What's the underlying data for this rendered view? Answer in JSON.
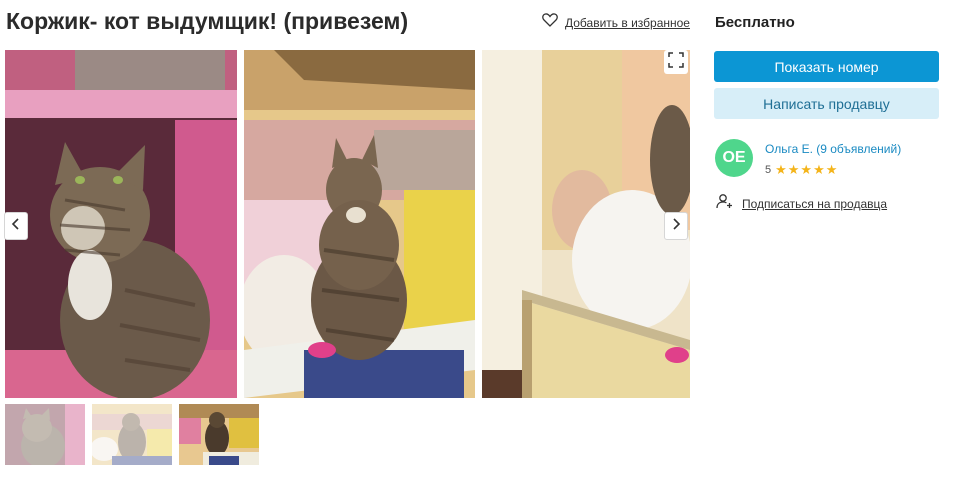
{
  "listing": {
    "title": "Коржик- кот выдумщик! (привезем)",
    "favorite_label": "Добавить в избранное",
    "price": "Бесплатно"
  },
  "actions": {
    "show_phone": "Показать номер",
    "write_seller": "Написать продавцу"
  },
  "seller": {
    "initials": "ОЕ",
    "name": "Ольга Е. (9 объявлений)",
    "rating": "5",
    "stars": "★★★★★",
    "subscribe": "Подписаться на продавца"
  },
  "icons": {
    "favorite": "heart-icon",
    "prev": "chevron-left-icon",
    "next": "chevron-right-icon",
    "fullscreen": "expand-icon",
    "subscribe": "user-plus-icon"
  },
  "colors": {
    "primary_button": "#0c96d4",
    "secondary_button": "#d7eef8",
    "avatar": "#4fd68c",
    "stars": "#f4b41a",
    "link": "#1a8ac2"
  }
}
